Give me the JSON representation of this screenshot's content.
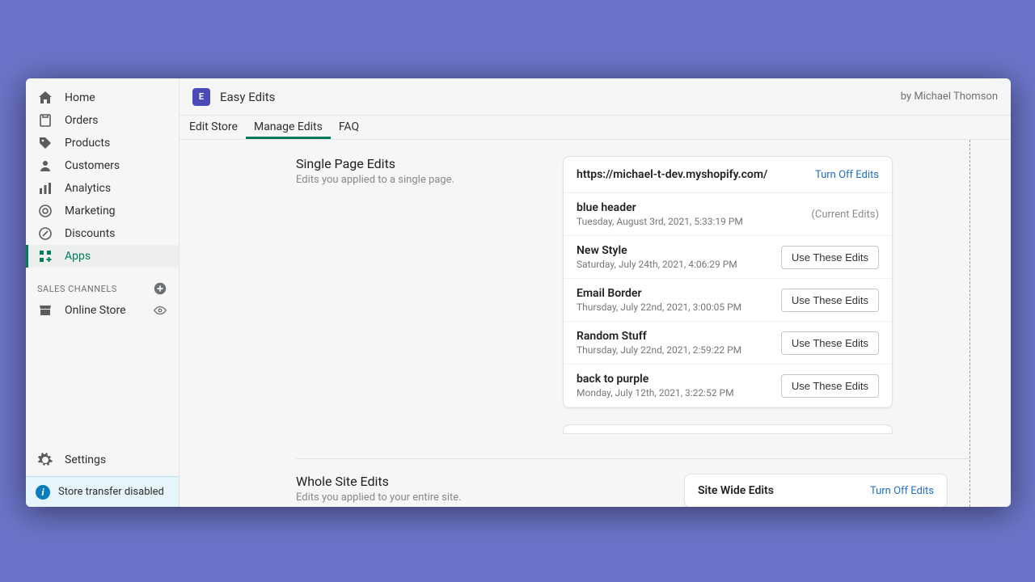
{
  "sidebar": {
    "items": [
      {
        "label": "Home"
      },
      {
        "label": "Orders"
      },
      {
        "label": "Products"
      },
      {
        "label": "Customers"
      },
      {
        "label": "Analytics"
      },
      {
        "label": "Marketing"
      },
      {
        "label": "Discounts"
      },
      {
        "label": "Apps"
      }
    ],
    "section_label": "SALES CHANNELS",
    "channel": "Online Store",
    "settings": "Settings",
    "banner": "Store transfer disabled"
  },
  "header": {
    "app_title": "Easy Edits",
    "author": "by Michael Thomson"
  },
  "tabs": [
    "Edit Store",
    "Manage Edits",
    "FAQ"
  ],
  "single_page": {
    "title": "Single Page Edits",
    "subtitle": "Edits you applied to a single page.",
    "url": "https://michael-t-dev.myshopify.com/",
    "turn_off": "Turn Off Edits",
    "current_label": "(Current Edits)",
    "use_label": "Use These Edits",
    "edits": [
      {
        "name": "blue header",
        "date": "Tuesday, August 3rd, 2021, 5:33:19 PM",
        "current": true
      },
      {
        "name": "New Style",
        "date": "Saturday, July 24th, 2021, 4:06:29 PM",
        "current": false
      },
      {
        "name": "Email Border",
        "date": "Thursday, July 22nd, 2021, 3:00:05 PM",
        "current": false
      },
      {
        "name": "Random Stuff",
        "date": "Thursday, July 22nd, 2021, 2:59:22 PM",
        "current": false
      },
      {
        "name": "back to purple",
        "date": "Monday, July 12th, 2021, 3:22:52 PM",
        "current": false
      }
    ]
  },
  "whole_site": {
    "title": "Whole Site Edits",
    "subtitle": "Edits you applied to your entire site.",
    "card_title": "Site Wide Edits",
    "turn_off": "Turn Off Edits"
  }
}
